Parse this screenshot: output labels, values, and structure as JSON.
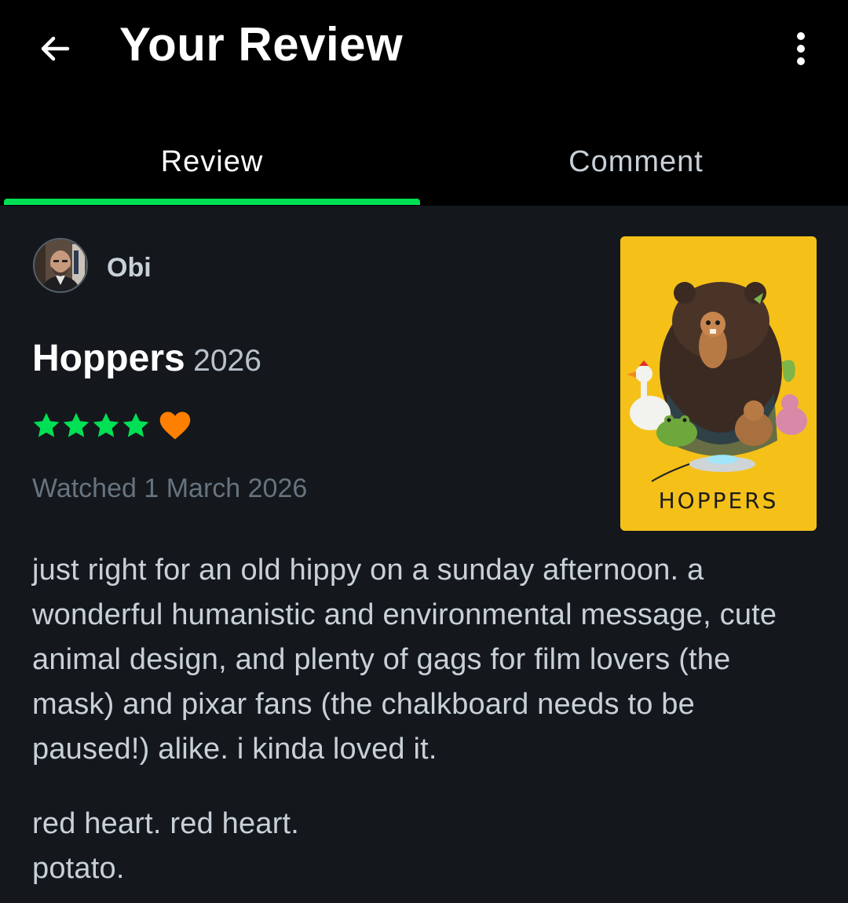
{
  "header": {
    "title": "Your Review",
    "back_icon": "arrow-left-icon",
    "more_icon": "more-vertical-icon"
  },
  "tabs": [
    {
      "label": "Review",
      "active": true
    },
    {
      "label": "Comment",
      "active": false
    }
  ],
  "reviewer": {
    "name": "Obi",
    "avatar_icon": "avatar-photo"
  },
  "film": {
    "title": "Hoppers",
    "year": "2026",
    "poster_title": "HOPPERS"
  },
  "rating": {
    "stars": 4,
    "out_of": 5,
    "liked": true,
    "star_color": "#00e054",
    "heart_color": "#ff8000"
  },
  "watched_date": "Watched 1 March 2026",
  "review": {
    "paragraph_1": "just right for an old hippy on a sunday afternoon. a wonderful humanistic and environmental message, cute animal design, and plenty of gags for film lovers (the mask) and pixar fans (the chalkboard needs to be paused!) alike. i kinda loved it.",
    "line_2": "red heart. red heart.",
    "line_3": "potato."
  },
  "colors": {
    "accent": "#00e054",
    "background": "#14181c",
    "header_background": "#000000"
  }
}
